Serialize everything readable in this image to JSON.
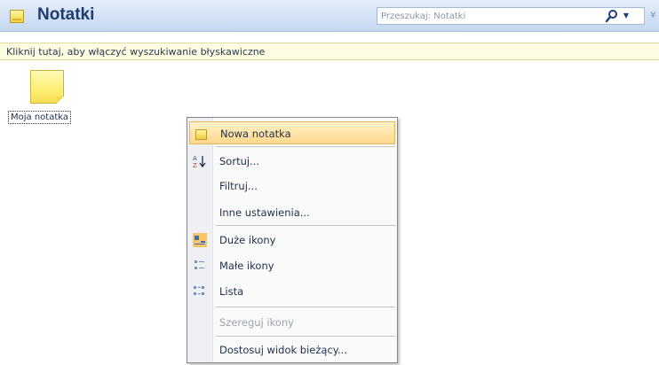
{
  "header": {
    "title": "Notatki",
    "search_placeholder": "Przeszukaj: Notatki"
  },
  "infobar": {
    "text": "Kliknij tutaj, aby włączyć wyszukiwanie błyskawiczne"
  },
  "items": [
    {
      "label": "Moja notatka"
    }
  ],
  "context_menu": {
    "new_note": "Nowa notatka",
    "sort": "Sortuj...",
    "filter": "Filtruj...",
    "other_settings": "Inne ustawienia...",
    "large_icons": "Duże ikony",
    "small_icons": "Małe ikony",
    "list": "Lista",
    "arrange_icons": "Szereguj ikony",
    "customize_view": "Dostosuj widok bieżący..."
  },
  "colors": {
    "header_bg": "#d3e1f5",
    "title": "#1f3c6d",
    "infobar_bg": "#fffde1",
    "menu_highlight": "#ffd78d",
    "note_yellow": "#ffef73"
  }
}
